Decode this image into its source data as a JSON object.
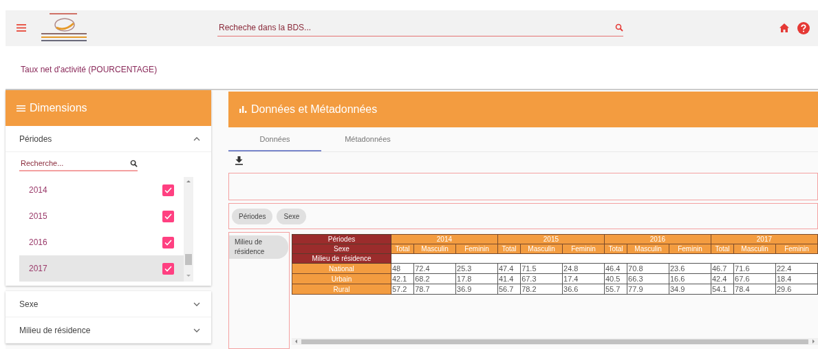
{
  "header": {
    "search_placeholder": "Recheche dans la BDS..."
  },
  "page_title": "Taux net d'activité (POURCENTAGE)",
  "dimensions": {
    "title": "Dimensions",
    "sections": [
      {
        "label": "Périodes",
        "expanded": true,
        "search_placeholder": "Recherche...",
        "items": [
          {
            "label": "2014",
            "checked": true,
            "selected": false
          },
          {
            "label": "2015",
            "checked": true,
            "selected": false
          },
          {
            "label": "2016",
            "checked": true,
            "selected": false
          },
          {
            "label": "2017",
            "checked": true,
            "selected": true
          }
        ]
      },
      {
        "label": "Sexe",
        "expanded": false
      },
      {
        "label": "Milieu de résidence",
        "expanded": false
      }
    ]
  },
  "data_panel": {
    "title": "Données et Métadonnées",
    "tabs": [
      {
        "label": "Données",
        "selected": true
      },
      {
        "label": "Métadonnées",
        "selected": false
      }
    ],
    "column_chips": [
      "Périodes",
      "Sexe"
    ],
    "row_chips": [
      "Milieu de résidence"
    ],
    "table": {
      "column_dims": [
        "Périodes",
        "Sexe"
      ],
      "row_dim": "Milieu de résidence",
      "periods": [
        {
          "label": "2014",
          "sexes": [
            "Total",
            "Masculin",
            "Feminin"
          ]
        },
        {
          "label": "2015",
          "sexes": [
            "Total",
            "Masculin",
            "Feminin"
          ]
        },
        {
          "label": "2016",
          "sexes": [
            "Total",
            "Masculin",
            "Feminin"
          ]
        },
        {
          "label": "2017",
          "sexes": [
            "Total",
            "Masculin",
            "Feminin"
          ]
        }
      ],
      "rows": [
        {
          "label": "National",
          "values": [
            "48",
            "72.4",
            "25.3",
            "47.4",
            "71.5",
            "24.8",
            "46.4",
            "70.8",
            "23.6",
            "46.7",
            "71.6",
            "22.4"
          ]
        },
        {
          "label": "Urbain",
          "values": [
            "42.1",
            "68.2",
            "17.8",
            "41.4",
            "67.3",
            "17.4",
            "40.5",
            "66.3",
            "16.6",
            "42.4",
            "67.6",
            "18.4"
          ]
        },
        {
          "label": "Rural",
          "values": [
            "57.2",
            "78.7",
            "36.9",
            "56.7",
            "78.2",
            "36.6",
            "55.7",
            "77.9",
            "34.9",
            "54.1",
            "78.4",
            "29.6"
          ]
        }
      ]
    }
  }
}
